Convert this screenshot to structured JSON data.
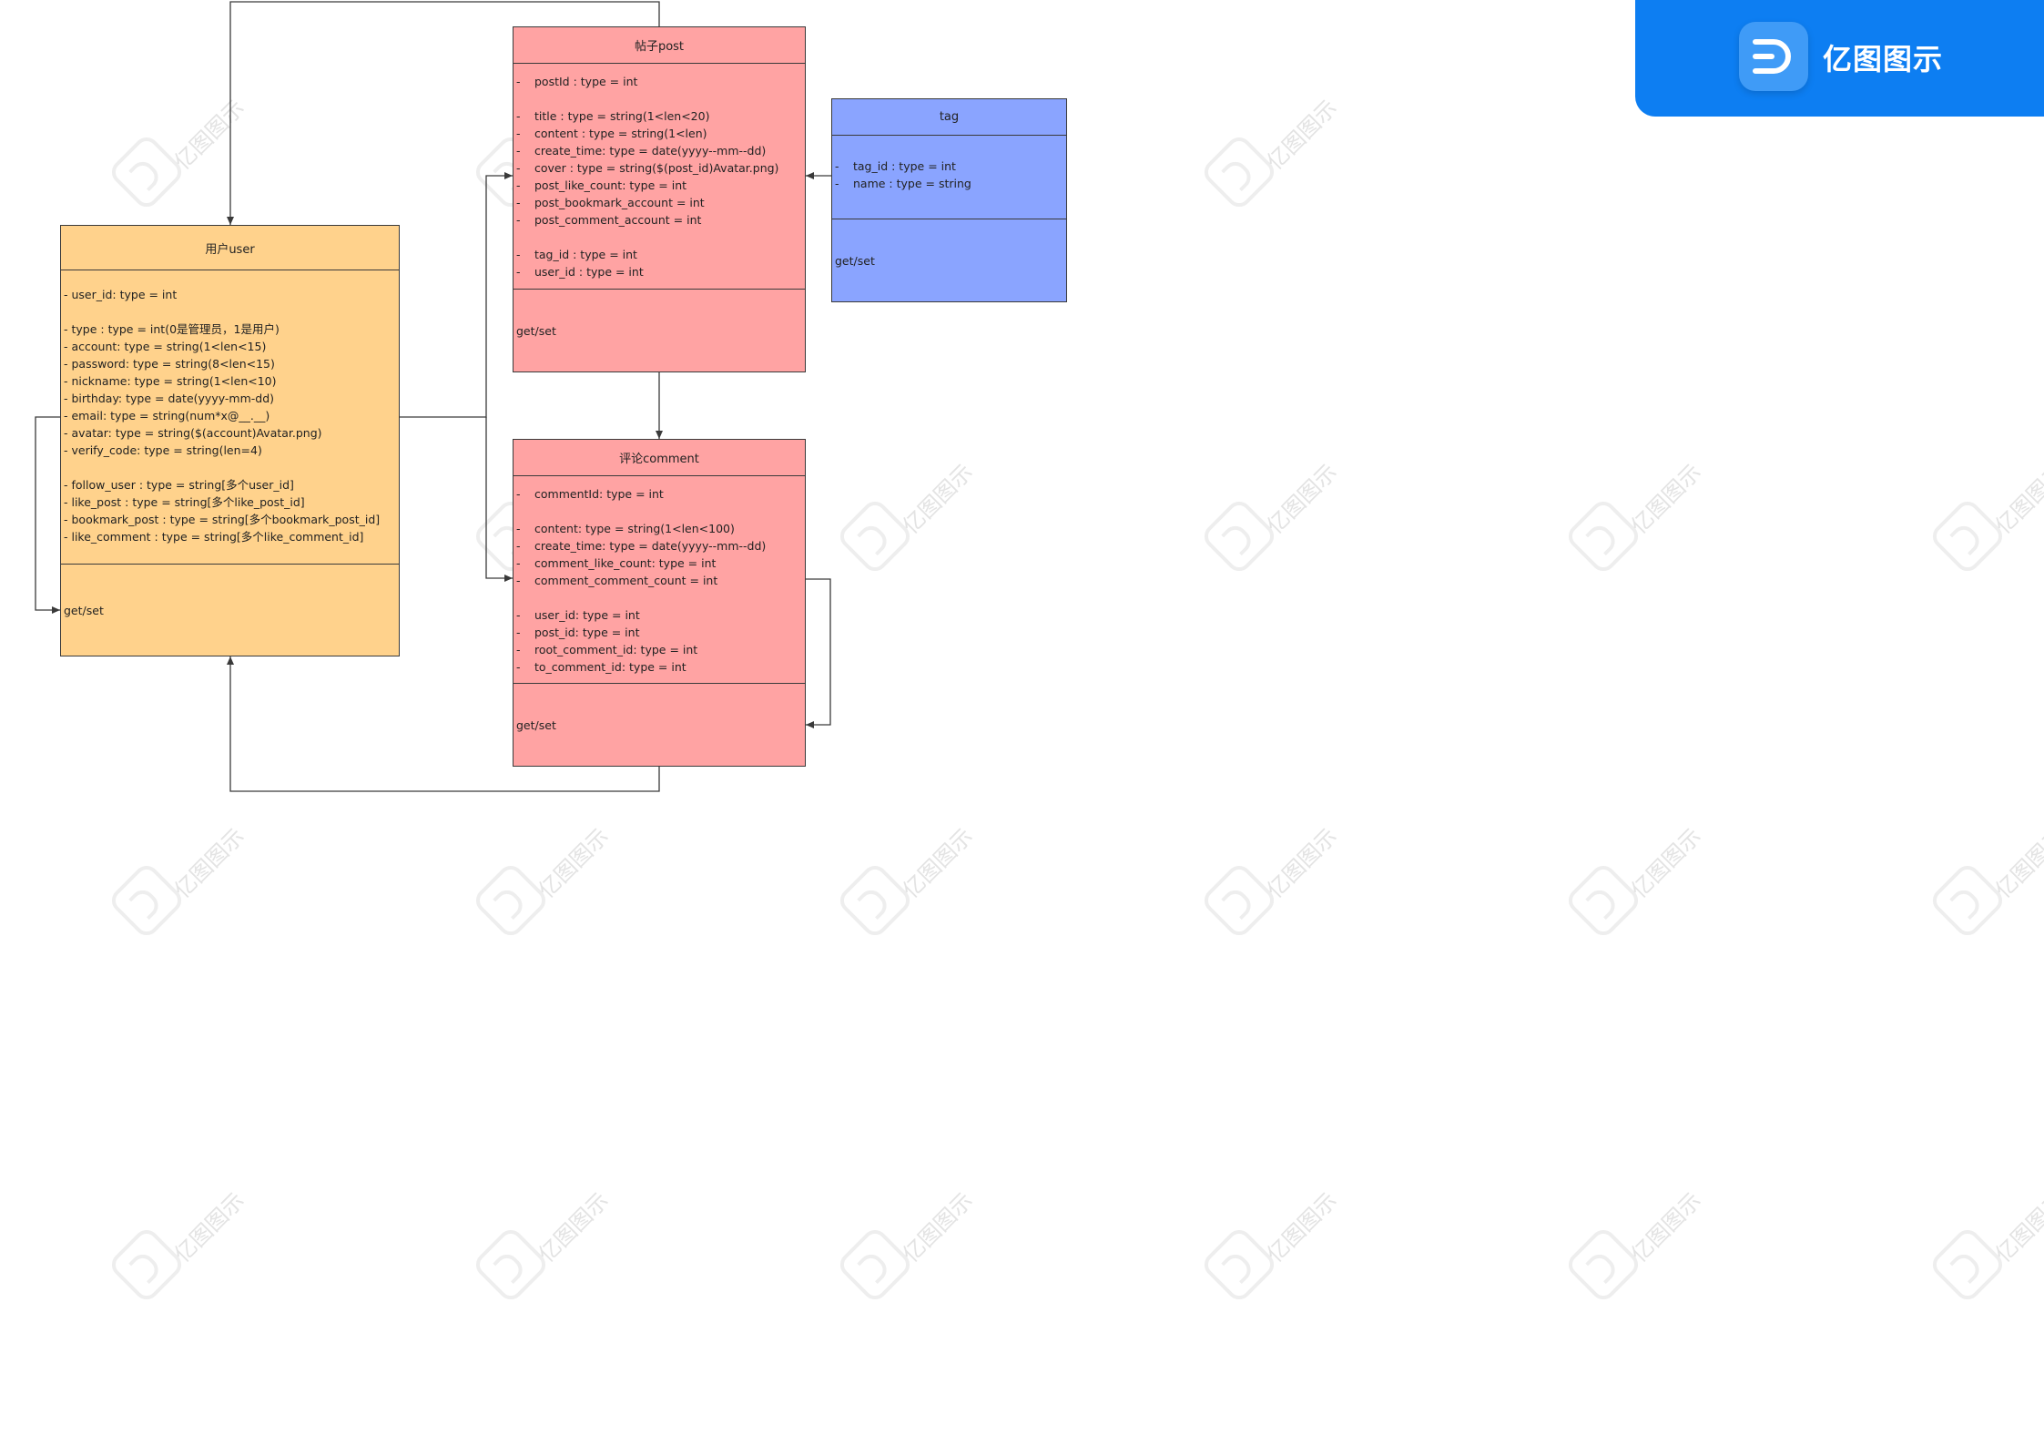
{
  "brand": {
    "name": "亿图图示",
    "logo": "edraw-logo-icon",
    "color": "#0d7ef2"
  },
  "watermark": {
    "text": "亿图图示"
  },
  "colors": {
    "user": "#ffd28c",
    "post": "#ffa3a3",
    "comment": "#ffa3a3",
    "tag": "#8aa4ff",
    "line": "#3a3a3a"
  },
  "classes": {
    "user": {
      "title": "用户user",
      "attributes": [
        "-  user_id: type = int",
        "",
        "-  type : type = int(0是管理员，1是用户)",
        "-  account: type = string(1<len<15)",
        "-  password: type = string(8<len<15)",
        "-  nickname: type = string(1<len<10)",
        "-  birthday: type = date(yyyy-mm-dd)",
        "-  email: type = string(num*x@__.__)",
        "- avatar: type = string($(account)Avatar.png)",
        "- verify_code: type = string(len=4)",
        "",
        "- follow_user : type = string[多个user_id]",
        "- like_post : type = string[多个like_post_id]",
        "- bookmark_post : type = string[多个bookmark_post_id]",
        "- like_comment : type = string[多个like_comment_id]"
      ],
      "methods": "get/set"
    },
    "post": {
      "title": "帖子post",
      "attributes": [
        {
          "dash": "-",
          "text": "postId : type = int"
        },
        {
          "dash": "",
          "text": ""
        },
        {
          "dash": "-",
          "text": "title : type = string(1<len<20)"
        },
        {
          "dash": "-",
          "text": "content : type = string(1<len)"
        },
        {
          "dash": "-",
          "text": "create_time: type = date(yyyy--mm--dd)"
        },
        {
          "dash": "-",
          "text": "cover : type = string($(post_id)Avatar.png)"
        },
        {
          "dash": "-",
          "text": "post_like_count: type = int"
        },
        {
          "dash": "-",
          "text": "post_bookmark_account = int"
        },
        {
          "dash": "-",
          "text": "post_comment_account = int"
        },
        {
          "dash": "",
          "text": ""
        },
        {
          "dash": "-",
          "text": "tag_id : type = int"
        },
        {
          "dash": "-",
          "text": "user_id : type = int"
        }
      ],
      "methods": "get/set"
    },
    "comment": {
      "title": "评论comment",
      "attributes": [
        {
          "dash": "-",
          "text": "commentId: type = int"
        },
        {
          "dash": "",
          "text": ""
        },
        {
          "dash": "-",
          "text": "content: type = string(1<len<100)"
        },
        {
          "dash": "-",
          "text": "create_time: type = date(yyyy--mm--dd)"
        },
        {
          "dash": "-",
          "text": "comment_like_count: type = int"
        },
        {
          "dash": "-",
          "text": "comment_comment_count = int"
        },
        {
          "dash": "",
          "text": ""
        },
        {
          "dash": "-",
          "text": "user_id: type = int"
        },
        {
          "dash": "-",
          "text": "post_id: type = int"
        },
        {
          "dash": "-",
          "text": "root_comment_id: type = int"
        },
        {
          "dash": "-",
          "text": "to_comment_id: type = int"
        }
      ],
      "methods": "get/set"
    },
    "tag": {
      "title": "tag",
      "attributes": [
        {
          "dash": "-",
          "text": "tag_id : type = int"
        },
        {
          "dash": "-",
          "text": "name : type = string"
        }
      ],
      "methods": "get/set"
    }
  }
}
